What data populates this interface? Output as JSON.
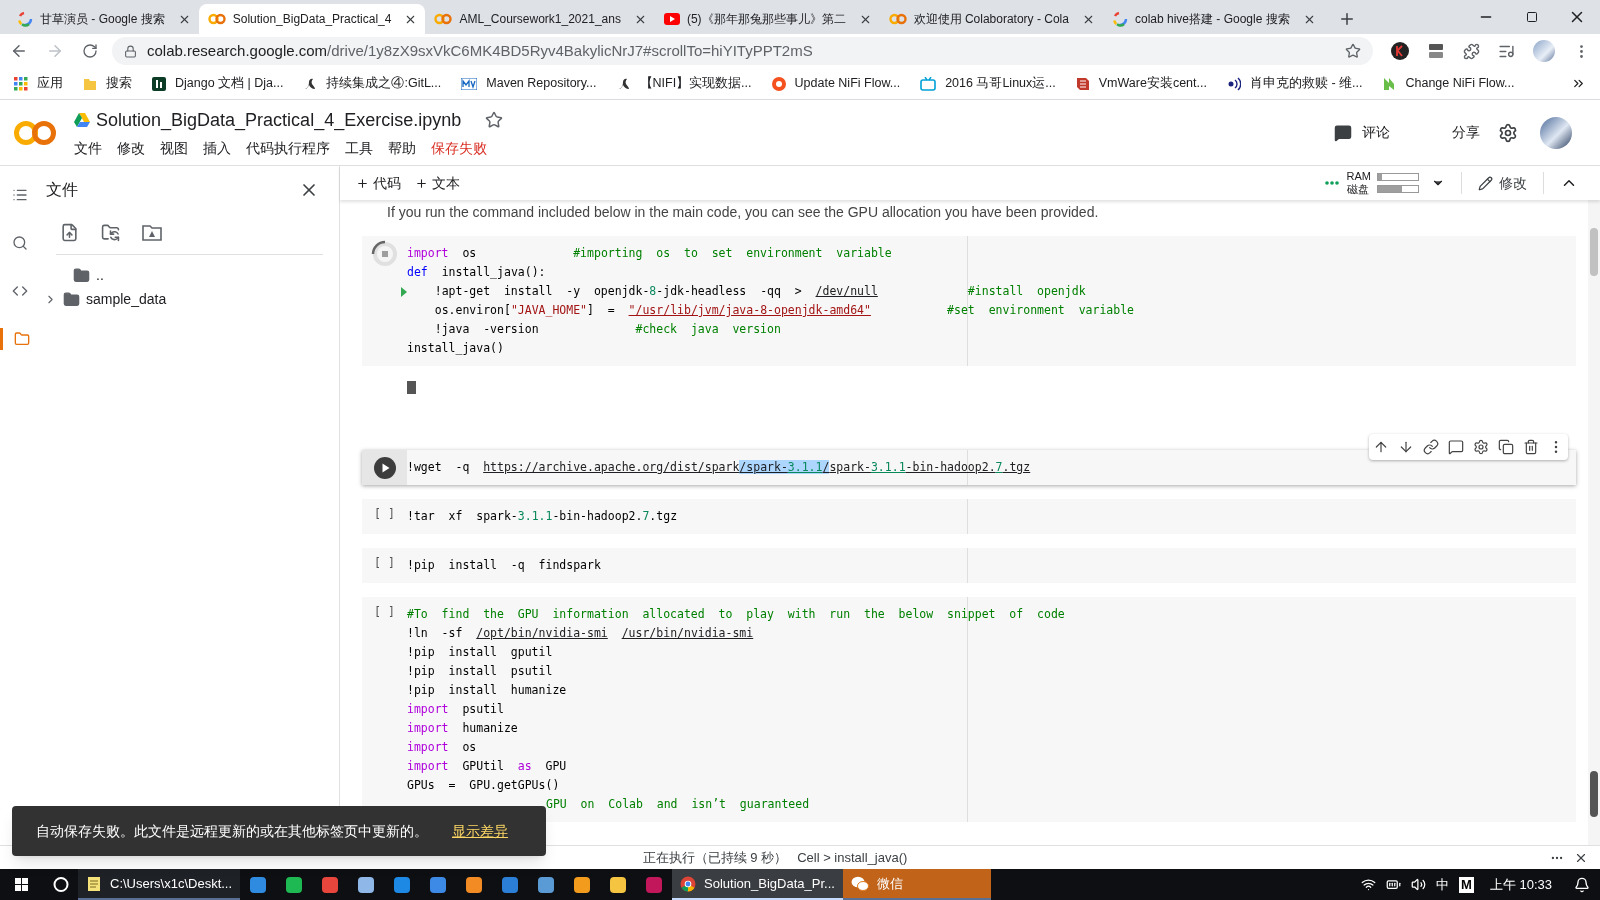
{
  "browser": {
    "tabs": [
      {
        "title": "甘草演员 - Google 搜索",
        "kind": "google",
        "selected": false
      },
      {
        "title": "Solution_BigData_Practical_4",
        "kind": "colab",
        "selected": true
      },
      {
        "title": "AML_Coursework1_2021_ans",
        "kind": "colab",
        "selected": false
      },
      {
        "title": "(5)《那年那兔那些事儿》第二",
        "kind": "youtube",
        "selected": false
      },
      {
        "title": "欢迎使用 Colaboratory - Cola",
        "kind": "colab",
        "selected": false
      },
      {
        "title": "colab hive搭建 - Google 搜索",
        "kind": "google",
        "selected": false
      }
    ],
    "address": {
      "host": "colab.research.google.com",
      "path": "/drive/1y8zX9sxVkC6MK4BD5Ryv4BakylicNrJ7#scrollTo=hiYITyPPT2mS"
    },
    "bookmarks": [
      {
        "label": "应用",
        "kind": "apps"
      },
      {
        "label": "搜索",
        "kind": "folder"
      },
      {
        "label": "Django 文档 | Dja...",
        "kind": "django"
      },
      {
        "label": "持续集成之④:GitL...",
        "kind": "bird"
      },
      {
        "label": "Maven Repository...",
        "kind": "maven"
      },
      {
        "label": "【NIFI】实现数据...",
        "kind": "bird"
      },
      {
        "label": "Update NiFi Flow...",
        "kind": "ring"
      },
      {
        "label": "2016 马哥Linux运...",
        "kind": "tv"
      },
      {
        "label": "VmWare安装cent...",
        "kind": "stripes"
      },
      {
        "label": "肖申克的救赎 - 维...",
        "kind": "sound"
      },
      {
        "label": "Change NiFi Flow...",
        "kind": "leaf"
      }
    ]
  },
  "notebook": {
    "title": "Solution_BigData_Practical_4_Exercise.ipynb",
    "starred": false,
    "menus": [
      "文件",
      "修改",
      "视图",
      "插入",
      "代码执行程序",
      "工具",
      "帮助"
    ],
    "save_status": "保存失败",
    "comment": "评论",
    "share": "分享"
  },
  "toolbar": {
    "add_code": "代码",
    "add_text": "文本",
    "ram_label": "RAM",
    "ram": {
      "level": 0.1
    },
    "disk_label": "磁盘",
    "disk": {
      "level": 0.6
    },
    "edit": "修改"
  },
  "sidebar": {
    "title": "文件",
    "nav": [
      {
        "kind": "toc",
        "selected": false
      },
      {
        "kind": "search",
        "selected": false
      },
      {
        "kind": "code",
        "selected": false
      },
      {
        "kind": "files",
        "selected": true
      }
    ],
    "tree": [
      {
        "kind": "parent",
        "name": ".."
      },
      {
        "kind": "folder",
        "name": "sample_data",
        "expanded": false
      }
    ]
  },
  "text_cell": "If you run the command included below in the main code, you can see the GPU allocation you have been provided.",
  "cells": [
    {
      "kind": "running",
      "output": {
        "kind": "cursor"
      },
      "lines": [
        {
          "current": false,
          "tokens": [
            {
              "text": "import",
              "kind": "kw"
            },
            {
              "text": "  os              ",
              "kind": "p"
            },
            {
              "text": "#importing  os  to  set  environment  variable",
              "kind": "com"
            }
          ]
        },
        {
          "current": false,
          "tokens": [
            {
              "text": "def",
              "kind": "def"
            },
            {
              "text": "  install_java():",
              "kind": "p"
            }
          ]
        },
        {
          "current": true,
          "tokens": [
            {
              "text": "    !apt-get  install  -y  openjdk-",
              "kind": "p"
            },
            {
              "text": "8",
              "kind": "num"
            },
            {
              "text": "-jdk-headless  -qq  >  ",
              "kind": "p"
            },
            {
              "text": "/dev/null",
              "kind": "path"
            },
            {
              "text": "             #install  openjdk",
              "kind": "com"
            }
          ]
        },
        {
          "current": false,
          "tokens": [
            {
              "text": "    os.environ[",
              "kind": "p"
            },
            {
              "text": "\"JAVA_HOME\"",
              "kind": "str"
            },
            {
              "text": "]  =  ",
              "kind": "p"
            },
            {
              "text": "\"/usr/lib/jvm/java-8-openjdk-amd64\"",
              "kind": "strpath"
            },
            {
              "text": "           #set  environment  variable",
              "kind": "com"
            }
          ]
        },
        {
          "current": false,
          "tokens": [
            {
              "text": "    !java  -version              ",
              "kind": "p"
            },
            {
              "text": "#check  java  version",
              "kind": "com"
            }
          ]
        },
        {
          "current": false,
          "tokens": [
            {
              "text": "install_java()",
              "kind": "p"
            }
          ]
        }
      ]
    },
    {
      "kind": "focused",
      "lines": [
        {
          "tokens": [
            {
              "text": "!wget  -q  ",
              "kind": "p"
            },
            {
              "text": "https://archive.apache.org/dist/spark",
              "kind": "url"
            },
            {
              "text": "/spark-",
              "kind": "sel"
            },
            {
              "text": "3.1.1",
              "kind": "selnum"
            },
            {
              "text": "/",
              "kind": "sel"
            },
            {
              "text": "spark-",
              "kind": "url"
            },
            {
              "text": "3.1.1",
              "kind": "urlnum"
            },
            {
              "text": "-bin-hadoop2.",
              "kind": "url"
            },
            {
              "text": "7",
              "kind": "urlnum"
            },
            {
              "text": ".tgz",
              "kind": "url"
            }
          ]
        }
      ]
    },
    {
      "kind": "idle",
      "prompt": "[ ]",
      "lines": [
        {
          "tokens": [
            {
              "text": "!tar  xf  spark-",
              "kind": "p"
            },
            {
              "text": "3.1.1",
              "kind": "num"
            },
            {
              "text": "-bin-hadoop2.",
              "kind": "p"
            },
            {
              "text": "7",
              "kind": "num"
            },
            {
              "text": ".tgz",
              "kind": "p"
            }
          ]
        }
      ]
    },
    {
      "kind": "idle",
      "prompt": "[ ]",
      "lines": [
        {
          "tokens": [
            {
              "text": "!pip  install  -q  findspark",
              "kind": "p"
            }
          ]
        }
      ]
    },
    {
      "kind": "idle",
      "prompt": "[ ]",
      "lines": [
        {
          "tokens": [
            {
              "text": "#To  find  the  GPU  information  allocated  to  play  with  run  the  below  snippet  of  code",
              "kind": "com"
            }
          ]
        },
        {
          "tokens": [
            {
              "text": "!ln  -sf  ",
              "kind": "p"
            },
            {
              "text": "/opt/bin/nvidia-smi",
              "kind": "path"
            },
            {
              "text": "  /usr/bin/nvidia-smi",
              "kind": "path"
            }
          ]
        },
        {
          "tokens": [
            {
              "text": "!pip  install  gputil",
              "kind": "p"
            }
          ]
        },
        {
          "tokens": [
            {
              "text": "!pip  install  psutil",
              "kind": "p"
            }
          ]
        },
        {
          "tokens": [
            {
              "text": "!pip  install  humanize",
              "kind": "p"
            }
          ]
        },
        {
          "tokens": [
            {
              "text": "import",
              "kind": "kw"
            },
            {
              "text": "  psutil",
              "kind": "p"
            }
          ]
        },
        {
          "tokens": [
            {
              "text": "import",
              "kind": "kw"
            },
            {
              "text": "  humanize",
              "kind": "p"
            }
          ]
        },
        {
          "tokens": [
            {
              "text": "import",
              "kind": "kw"
            },
            {
              "text": "  os",
              "kind": "p"
            }
          ]
        },
        {
          "tokens": [
            {
              "text": "import",
              "kind": "kw"
            },
            {
              "text": "  GPUtil  ",
              "kind": "p"
            },
            {
              "text": "as",
              "kind": "kw"
            },
            {
              "text": "  GPU",
              "kind": "p"
            }
          ]
        },
        {
          "tokens": [
            {
              "text": "GPUs  =  GPU.getGPUs()",
              "kind": "p"
            }
          ]
        }
      ],
      "tail": [
        {
          "text": "GPU  on  Colab  and  isn’t  guaranteed",
          "kind": "com"
        }
      ]
    }
  ],
  "toast": {
    "message": "自动保存失败。此文件是远程更新的或在其他标签页中更新的。",
    "link": "显示差异"
  },
  "status_bar": {
    "execution": "正在执行（已持续 9 秒）",
    "cell": "Cell > install_java()"
  },
  "taskbar": {
    "items": [
      {
        "kind": "notepad",
        "label": "C:\\Users\\x1c\\Deskt...",
        "selected": false,
        "alert": false
      },
      {
        "kind": "pin",
        "color": "#2f8be0"
      },
      {
        "kind": "pin",
        "color": "#1fb954"
      },
      {
        "kind": "pin",
        "color": "#e8453c"
      },
      {
        "kind": "pin",
        "color": "#8fb8e8"
      },
      {
        "kind": "pin",
        "color": "#1e88e5"
      },
      {
        "kind": "pin",
        "color": "#3d8ae6"
      },
      {
        "kind": "pin",
        "color": "#f28b24"
      },
      {
        "kind": "pin",
        "color": "#2c7fd6"
      },
      {
        "kind": "pin",
        "color": "#5b9bd5"
      },
      {
        "kind": "pin",
        "color": "#f29b1d"
      },
      {
        "kind": "pin",
        "color": "#f5c542"
      },
      {
        "kind": "pin",
        "color": "#c2185b"
      },
      {
        "kind": "chrome",
        "label": "Solution_BigData_Pr...",
        "selected": true,
        "alert": false
      },
      {
        "kind": "wechat",
        "label": "微信",
        "selected": false,
        "alert": true
      }
    ],
    "ime": "中",
    "ime_mode": "M",
    "clock": "上午 10:33"
  }
}
